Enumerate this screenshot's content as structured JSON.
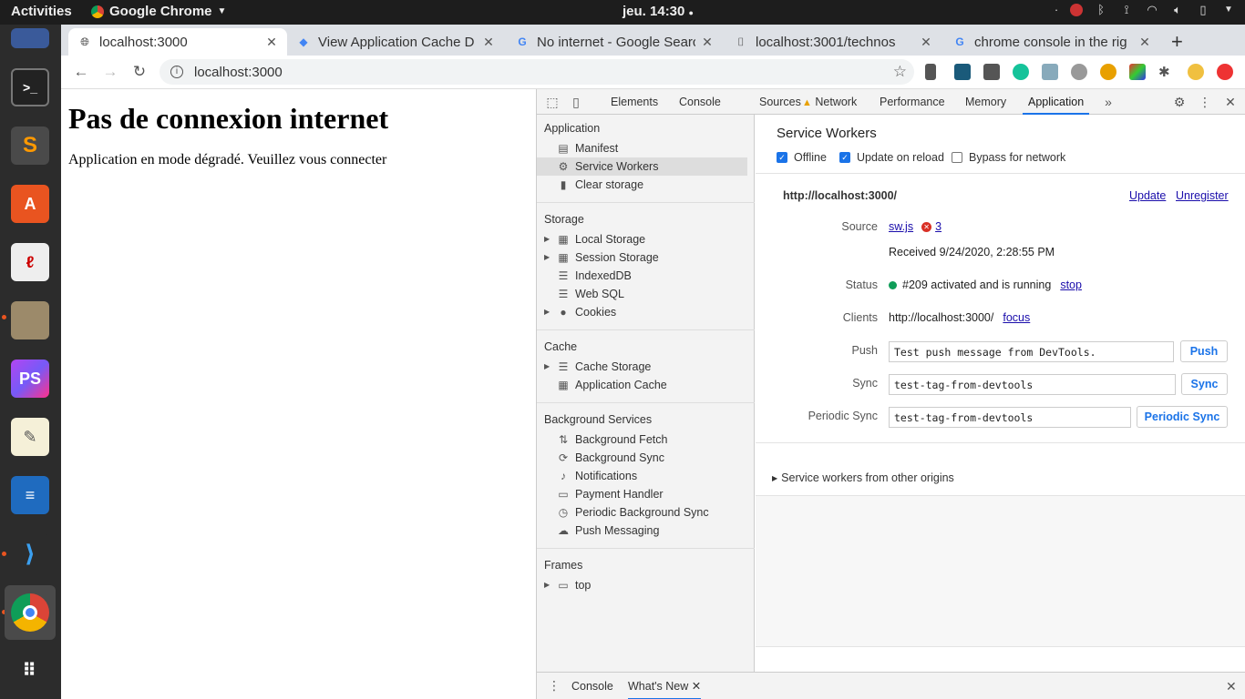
{
  "topbar": {
    "activities": "Activities",
    "app_name": "Google Chrome",
    "clock": "jeu. 14:30"
  },
  "tabs": [
    {
      "title": "localhost:3000",
      "favicon": "globe-icon",
      "active": true
    },
    {
      "title": "View Application Cache D",
      "favicon": "devtools-icon",
      "active": false
    },
    {
      "title": "No internet - Google Searc",
      "favicon": "google-icon",
      "active": false
    },
    {
      "title": "localhost:3001/technos",
      "favicon": "page-icon",
      "active": false
    },
    {
      "title": "chrome console in the rig",
      "favicon": "google-icon",
      "active": false
    }
  ],
  "omnibox": {
    "url": "localhost:3000"
  },
  "page": {
    "heading": "Pas de connexion internet",
    "text": "Application en mode dégradé. Veuillez vous connecter"
  },
  "devtools": {
    "tabs": [
      "Elements",
      "Console",
      "Sources",
      "Network",
      "Performance",
      "Memory",
      "Application"
    ],
    "active_tab": "Application",
    "sidebar": {
      "application": {
        "title": "Application",
        "items": [
          "Manifest",
          "Service Workers",
          "Clear storage"
        ],
        "selected": "Service Workers"
      },
      "storage": {
        "title": "Storage",
        "items": [
          "Local Storage",
          "Session Storage",
          "IndexedDB",
          "Web SQL",
          "Cookies"
        ]
      },
      "cache": {
        "title": "Cache",
        "items": [
          "Cache Storage",
          "Application Cache"
        ]
      },
      "background": {
        "title": "Background Services",
        "items": [
          "Background Fetch",
          "Background Sync",
          "Notifications",
          "Payment Handler",
          "Periodic Background Sync",
          "Push Messaging"
        ]
      },
      "frames": {
        "title": "Frames",
        "items": [
          "top"
        ]
      }
    },
    "sw": {
      "title": "Service Workers",
      "offline_label": "Offline",
      "offline_checked": true,
      "update_label": "Update on reload",
      "update_checked": true,
      "bypass_label": "Bypass for network",
      "bypass_checked": false,
      "origin": "http://localhost:3000/",
      "update_link": "Update",
      "unregister_link": "Unregister",
      "source_label": "Source",
      "source_file": "sw.js",
      "error_count": "3",
      "received": "Received 9/24/2020, 2:28:55 PM",
      "status_label": "Status",
      "status_text": "#209 activated and is running",
      "stop_link": "stop",
      "clients_label": "Clients",
      "clients_value": "http://localhost:3000/",
      "focus_link": "focus",
      "push_label": "Push",
      "push_value": "Test push message from DevTools.",
      "push_button": "Push",
      "sync_label": "Sync",
      "sync_value": "test-tag-from-devtools",
      "sync_button": "Sync",
      "periodic_label": "Periodic Sync",
      "periodic_value": "test-tag-from-devtools",
      "periodic_button": "Periodic Sync",
      "other_origins": "Service workers from other origins"
    },
    "drawer": {
      "tabs": [
        "Console",
        "What's New"
      ],
      "active": "What's New"
    }
  }
}
